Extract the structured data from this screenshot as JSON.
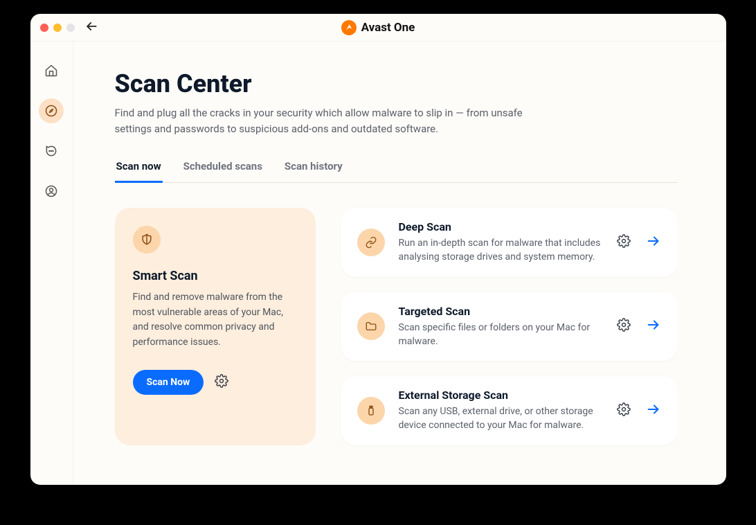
{
  "brand": "Avast One",
  "page": {
    "title": "Scan Center",
    "subtitle": "Find and plug all the cracks in your security which allow malware to slip in — from unsafe settings and passwords to suspicious add-ons and outdated software."
  },
  "tabs": [
    {
      "label": "Scan now",
      "active": true
    },
    {
      "label": "Scheduled scans",
      "active": false
    },
    {
      "label": "Scan history",
      "active": false
    }
  ],
  "smart_scan": {
    "title": "Smart Scan",
    "description": "Find and remove malware from the most vulnerable areas of your Mac, and resolve common privacy and performance issues.",
    "button": "Scan Now"
  },
  "scans": [
    {
      "title": "Deep Scan",
      "description": "Run an in-depth scan for malware that includes analysing storage drives and system memory.",
      "icon": "link-icon"
    },
    {
      "title": "Targeted Scan",
      "description": "Scan specific files or folders on your Mac for malware.",
      "icon": "folder-icon"
    },
    {
      "title": "External Storage Scan",
      "description": "Scan any USB, external drive, or other storage device connected to your Mac for malware.",
      "icon": "usb-icon"
    }
  ]
}
